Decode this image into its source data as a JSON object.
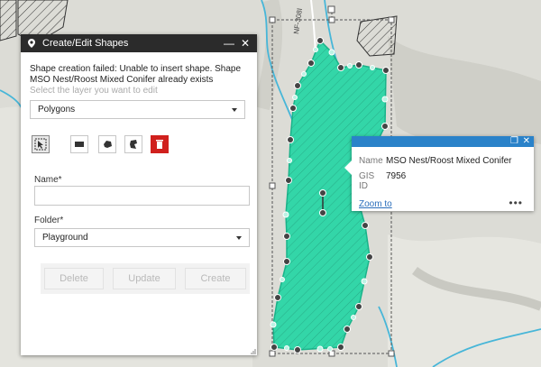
{
  "map": {
    "road_label": "NF-308I",
    "colors": {
      "terrain": "#dcdcd6",
      "polygon_fill": "#33d6a8",
      "stream": "#47b6d8"
    }
  },
  "panel": {
    "title": "Create/Edit Shapes",
    "error_message": "Shape creation failed: Unable to insert shape. Shape MSO Nest/Roost Mixed Conifer already exists",
    "hint": "Select the layer you want to edit",
    "layer_select": "Polygons",
    "tools": [
      "select-tool",
      "rectangle-tool",
      "freehand-tool",
      "cut-tool",
      "delete-tool"
    ],
    "name_label": "Name*",
    "name_value": "",
    "folder_label": "Folder*",
    "folder_value": "Playground",
    "buttons": {
      "delete": "Delete",
      "update": "Update",
      "create": "Create"
    },
    "header_minimize": "—",
    "header_close": "✕"
  },
  "popup": {
    "name_key": "Name",
    "name_value": "MSO Nest/Roost Mixed Conifer",
    "gisid_key": "GIS ID",
    "gisid_value": "7956",
    "zoom_link": "Zoom to",
    "more": "•••",
    "maximize": "❐",
    "close": "✕"
  }
}
